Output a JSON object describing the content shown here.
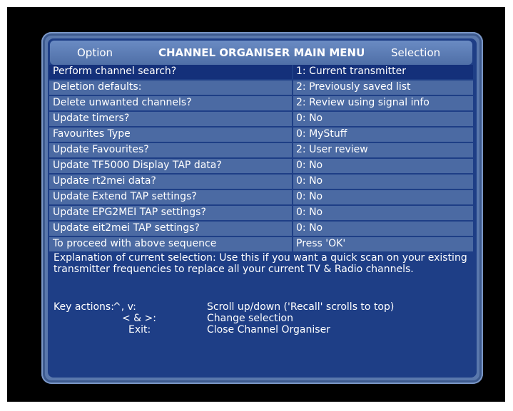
{
  "header": {
    "option": "Option",
    "title": "CHANNEL ORGANISER MAIN MENU",
    "selection": "Selection"
  },
  "rows": [
    {
      "label": "Perform channel search?",
      "value": "1: Current transmitter",
      "selected": true
    },
    {
      "label": "Deletion defaults:",
      "value": "2: Previously saved list"
    },
    {
      "label": "Delete unwanted channels?",
      "value": "2: Review using signal info"
    },
    {
      "label": "Update timers?",
      "value": "0: No"
    },
    {
      "label": "Favourites Type",
      "value": "0: MyStuff"
    },
    {
      "label": "Update Favourites?",
      "value": "2: User review"
    },
    {
      "label": "Update TF5000 Display TAP data?",
      "value": "0: No"
    },
    {
      "label": "Update rt2mei data?",
      "value": "0: No"
    },
    {
      "label": "Update Extend TAP settings?",
      "value": "0: No"
    },
    {
      "label": "Update EPG2MEI TAP settings?",
      "value": "0: No"
    },
    {
      "label": "Update eit2mei TAP settings?",
      "value": "0: No"
    },
    {
      "label": "To proceed with above sequence",
      "value": "Press 'OK'"
    }
  ],
  "explanation": "Explanation of current selection: Use this if you want a quick scan on your existing transmitter frequencies to replace all your current TV & Radio channels.",
  "keys": {
    "title": "Key actions:",
    "items": [
      {
        "key": "^, v:",
        "action": "Scroll up/down ('Recall' scrolls to top)"
      },
      {
        "key": "< & >:",
        "action": "Change selection"
      },
      {
        "key": "Exit:",
        "action": "Close Channel Organiser"
      }
    ]
  },
  "colors": {
    "panel": "#5a78ac",
    "inner": "#1e3e86",
    "row": "#4b6aa3",
    "row_selected": "#14307a"
  }
}
